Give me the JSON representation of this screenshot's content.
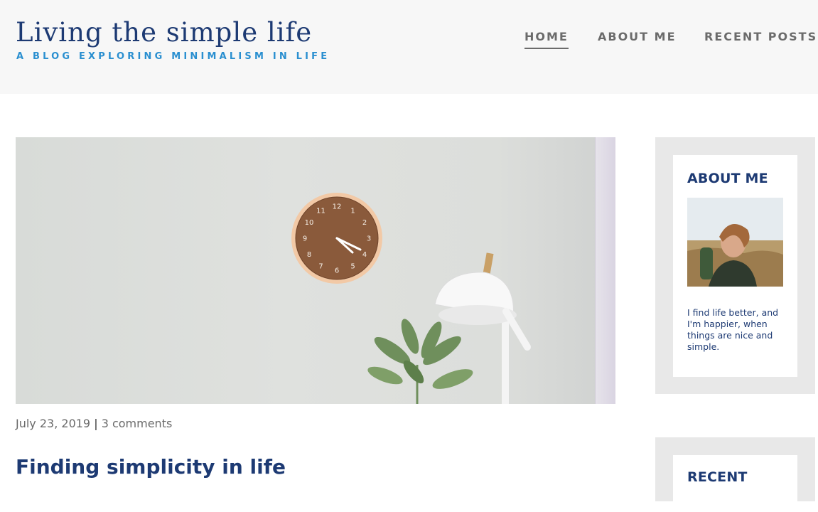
{
  "site": {
    "title": "Living the simple life",
    "tagline": "A BLOG EXPLORING MINIMALISM IN LIFE"
  },
  "nav": {
    "items": [
      {
        "label": "HOME",
        "active": true
      },
      {
        "label": "ABOUT ME",
        "active": false
      },
      {
        "label": "RECENT POSTS",
        "active": false
      }
    ]
  },
  "post": {
    "date": "July 23, 2019",
    "separator": "|",
    "comments": "3 comments",
    "title": "Finding simplicity in life",
    "clock_numbers": [
      "12",
      "1",
      "2",
      "3",
      "4",
      "5",
      "6",
      "7",
      "8",
      "9",
      "10",
      "11"
    ]
  },
  "sidebar": {
    "about": {
      "heading": "ABOUT ME",
      "text": "I find life better, and I'm happier, when things are nice and simple."
    },
    "recent": {
      "heading": "RECENT"
    }
  },
  "colors": {
    "brand_navy": "#1d3a73",
    "tagline_blue": "#2a8fd0",
    "nav_gray": "#6b6b6b",
    "header_bg": "#f7f7f7",
    "widget_bg": "#e8e8e8"
  }
}
